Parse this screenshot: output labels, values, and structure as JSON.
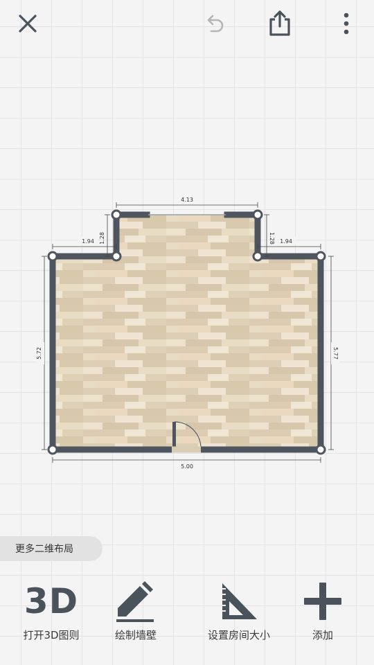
{
  "header": {
    "close_icon": "close-icon",
    "undo_icon": "undo-icon",
    "share_icon": "share-icon",
    "more_icon": "more-vertical-icon"
  },
  "plan": {
    "dimensions": {
      "top_opening": "4.13",
      "left_step_width": "1.94",
      "left_step_height": "1.28",
      "right_step_height": "1.28",
      "right_step_width": "1.94",
      "left_height": "5.72",
      "right_height": "5.77",
      "bottom_width": "5.00"
    },
    "colors": {
      "wall": "#4e555f",
      "floor": "#e3d5bd",
      "corner": "#ffffff"
    }
  },
  "more_layouts": {
    "label": "更多二维布局"
  },
  "toolbar": {
    "open_3d": {
      "icon_text": "3D",
      "label": "打开3D图则"
    },
    "draw_walls": {
      "label": "绘制墙壁",
      "icon": "pencil-icon"
    },
    "room_size": {
      "label": "设置房间大小",
      "icon": "set-square-icon"
    },
    "add": {
      "label": "添加",
      "icon": "plus-icon"
    }
  }
}
